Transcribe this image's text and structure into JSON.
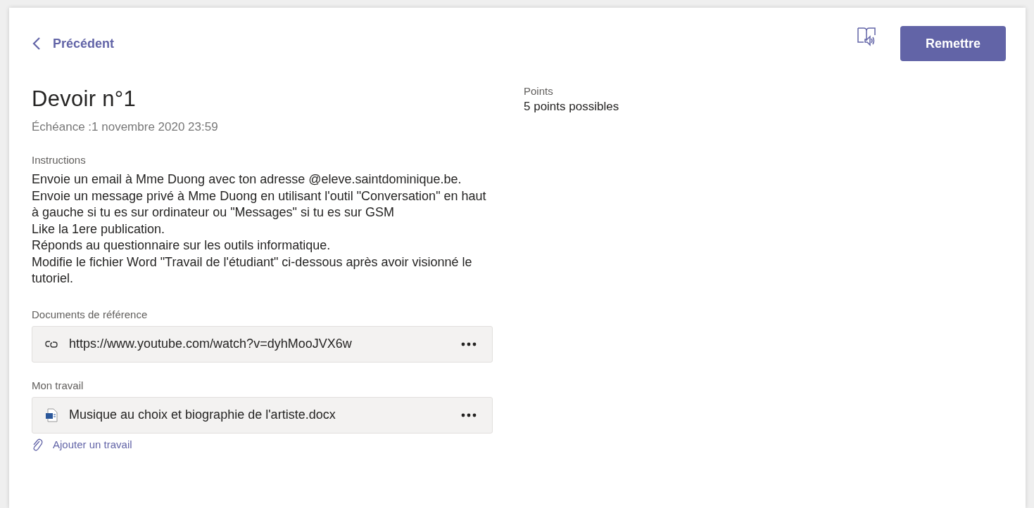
{
  "header": {
    "back_label": "Précédent",
    "submit_label": "Remettre"
  },
  "assignment": {
    "title": "Devoir n°1",
    "due": "Échéance :1 novembre 2020 23:59",
    "instructions_label": "Instructions",
    "instructions": [
      "Envoie un email à Mme Duong avec ton adresse @eleve.saintdominique.be.",
      "Envoie un message privé à Mme Duong en utilisant l'outil \"Conversation\" en haut à gauche si tu es sur ordinateur ou \"Messages\" si tu es sur GSM",
      "Like la 1ere publication.",
      "Réponds au questionnaire sur les outils informatique.",
      "Modifie le fichier Word \"Travail de l'étudiant\" ci-dessous après avoir visionné le tutoriel."
    ],
    "reference_label": "Documents de référence",
    "references": [
      {
        "kind": "link",
        "name": "https://www.youtube.com/watch?v=dyhMooJVX6w"
      }
    ],
    "work_label": "Mon travail",
    "work": [
      {
        "kind": "word",
        "name": "Musique au choix et biographie de l'artiste.docx"
      }
    ],
    "add_work_label": "Ajouter un travail"
  },
  "points": {
    "label": "Points",
    "value": "5 points possibles"
  }
}
